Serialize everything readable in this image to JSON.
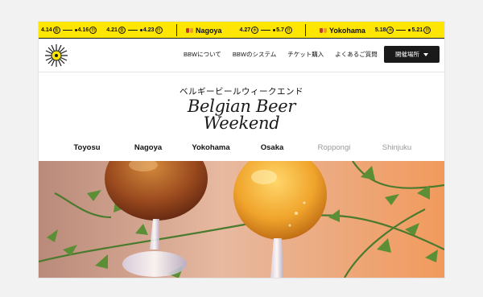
{
  "ticker": {
    "seg1": {
      "d1": "4.14",
      "w1": "金",
      "d2": "4.16",
      "w2": "日",
      "d3": "4.21",
      "w3": "金",
      "d4": "4.23",
      "w4": "日"
    },
    "seg2": {
      "city": "Nagoya",
      "d1": "4.27",
      "w1": "木",
      "d2": "5.7",
      "w2": "日"
    },
    "seg3": {
      "city": "Yokohama",
      "d1": "5.18",
      "w1": "木",
      "d2": "5.21",
      "w2": "日"
    }
  },
  "nav": {
    "about": "BBWについて",
    "system": "BBWのシステム",
    "tickets": "チケット購入",
    "faq": "よくあるご質問",
    "venue_button": "開催場所"
  },
  "hero": {
    "jp_title": "ベルギービールウィークエンド",
    "en_title_line1": "Belgian Beer",
    "en_title_line2": "Weekend"
  },
  "tabs": [
    "Toyosu",
    "Nagoya",
    "Yokohama",
    "Osaka",
    "Roppongi",
    "Shinjuku"
  ],
  "colors": {
    "ticker_bg": "#ffe600",
    "button_bg": "#1a1a1a",
    "dim_tab": "#999999"
  }
}
